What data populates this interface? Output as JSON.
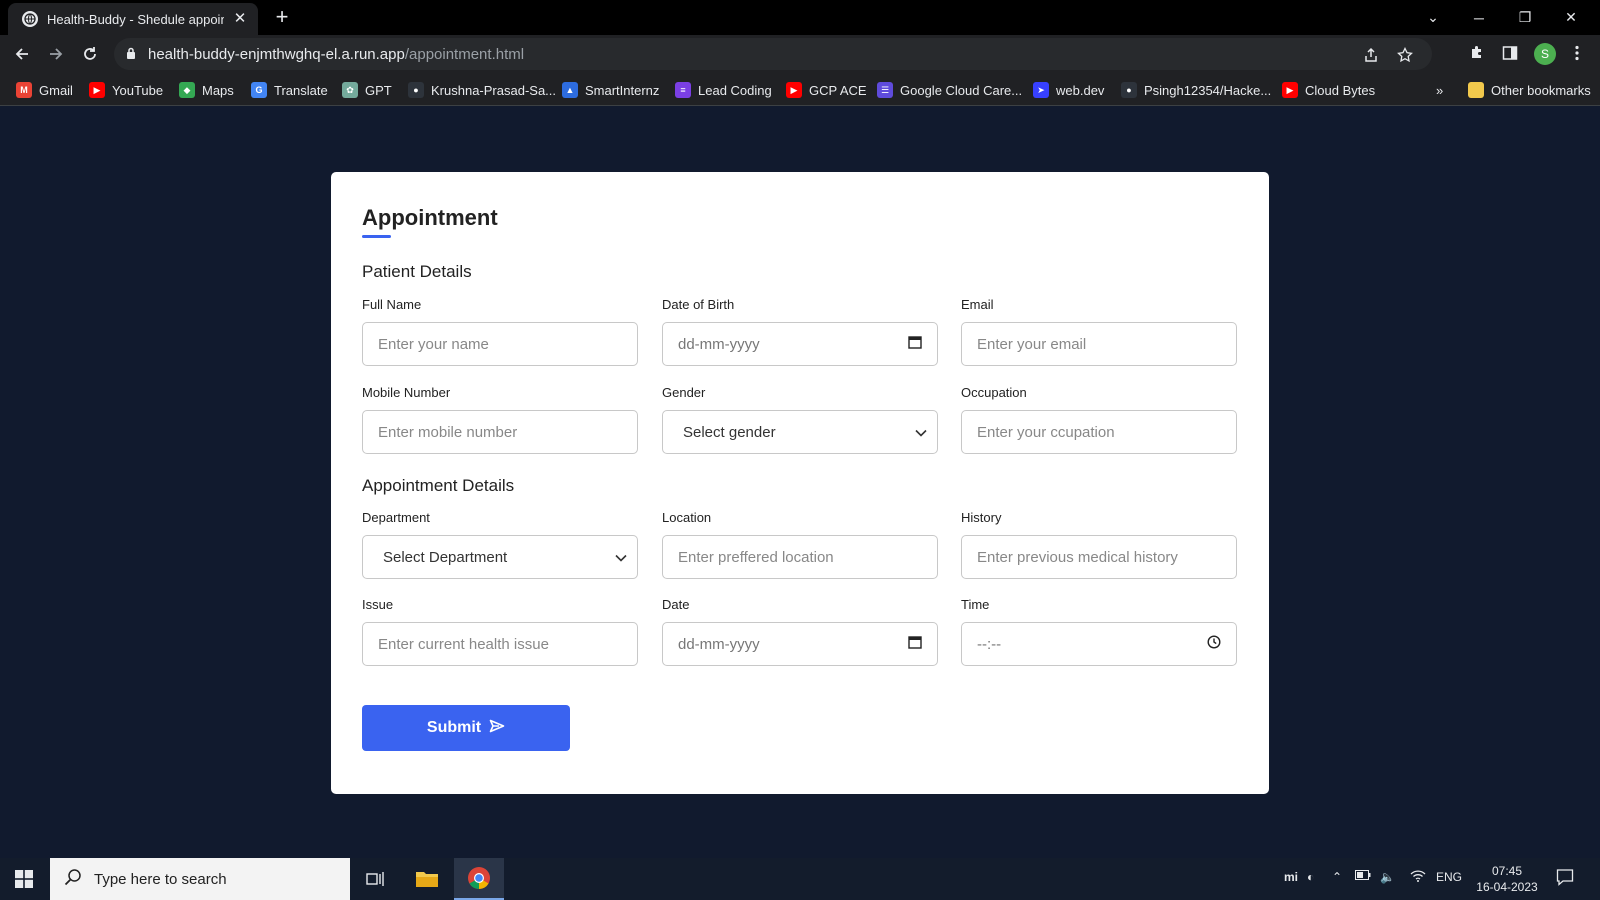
{
  "browser": {
    "tab_title": "Health-Buddy - Shedule appointment",
    "url_host": "health-buddy-enjmthwghq-el.a.run.app",
    "url_path": "/appointment.html",
    "profile_initial": "S",
    "bookmarks": [
      {
        "label": "Gmail",
        "icon": "gmail-icon",
        "color": "#ea4335"
      },
      {
        "label": "YouTube",
        "icon": "youtube-icon",
        "color": "#ff0000"
      },
      {
        "label": "Maps",
        "icon": "maps-icon",
        "color": "#34a853"
      },
      {
        "label": "Translate",
        "icon": "translate-icon",
        "color": "#4285f4"
      },
      {
        "label": "GPT",
        "icon": "gpt-icon",
        "color": "#74aa9c"
      },
      {
        "label": "Krushna-Prasad-Sa...",
        "icon": "github-icon",
        "color": "#2d333b"
      },
      {
        "label": "SmartInternz",
        "icon": "smartinternz-icon",
        "color": "#2d6cdf"
      },
      {
        "label": "Lead Coding",
        "icon": "leadcoding-icon",
        "color": "#7b3fe4"
      },
      {
        "label": "GCP ACE",
        "icon": "youtube-icon",
        "color": "#ff0000"
      },
      {
        "label": "Google Cloud Care...",
        "icon": "google-cloud-icon",
        "color": "#5f4bdb"
      },
      {
        "label": "web.dev",
        "icon": "webdev-icon",
        "color": "#3740ff"
      },
      {
        "label": "Psingh12354/Hacke...",
        "icon": "github-icon",
        "color": "#2d333b"
      },
      {
        "label": "Cloud Bytes",
        "icon": "youtube-icon",
        "color": "#ff0000"
      }
    ],
    "bookmarks_overflow": "»",
    "other_bookmarks": "Other bookmarks"
  },
  "form": {
    "title": "Appointment",
    "patient_section": "Patient Details",
    "appointment_section": "Appointment Details",
    "fields": {
      "full_name": {
        "label": "Full Name",
        "placeholder": "Enter your name"
      },
      "dob": {
        "label": "Date of Birth",
        "placeholder": "dd-mm-yyyy"
      },
      "email": {
        "label": "Email",
        "placeholder": "Enter your email"
      },
      "mobile": {
        "label": "Mobile Number",
        "placeholder": "Enter mobile number"
      },
      "gender": {
        "label": "Gender",
        "value": "Select gender"
      },
      "occupation": {
        "label": "Occupation",
        "placeholder": "Enter your ccupation"
      },
      "department": {
        "label": "Department",
        "value": "Select Department"
      },
      "location": {
        "label": "Location",
        "placeholder": "Enter preffered location"
      },
      "history": {
        "label": "History",
        "placeholder": "Enter previous medical history"
      },
      "issue": {
        "label": "Issue",
        "placeholder": "Enter current health issue"
      },
      "date": {
        "label": "Date",
        "placeholder": "dd-mm-yyyy"
      },
      "time": {
        "label": "Time",
        "placeholder": "--:--"
      }
    },
    "submit_label": "Submit",
    "accent_color": "#3a63f0"
  },
  "taskbar": {
    "search_placeholder": "Type here to search",
    "language": "ENG",
    "time": "07:45",
    "date": "16-04-2023"
  }
}
